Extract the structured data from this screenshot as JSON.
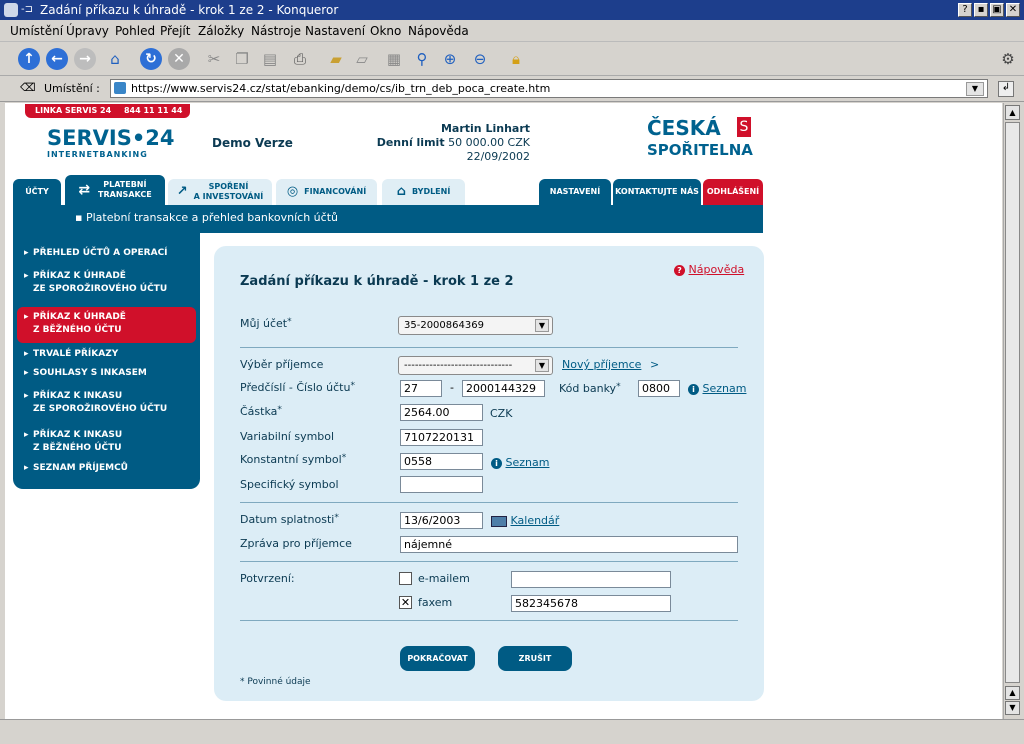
{
  "window": {
    "title": "Zadání příkazu k úhradě - krok 1 ze 2 - Konqueror",
    "btns": [
      "?",
      "▪",
      "▣",
      "✕"
    ]
  },
  "menu": [
    "Umístění",
    "Úpravy",
    "Pohled",
    "Přejít",
    "Záložky",
    "Nástroje",
    "Nastavení",
    "Okno",
    "Nápověda"
  ],
  "location": {
    "label": "Umístění :",
    "url": "https://www.servis24.cz/stat/ebanking/demo/cs/ib_trn_deb_poca_create.htm"
  },
  "header": {
    "hotline": "LINKA SERVIS 24",
    "phone": "844 11 11 44",
    "logo_main": "SERVIS•24",
    "logo_sub": "INTERNETBANKING",
    "demo": "Demo Verze",
    "user": "Martin Linhart",
    "limit_label": "Denní limit",
    "limit_value": "50 000.00 CZK",
    "date": "22/09/2002",
    "bank1": "ČESKÁ",
    "bank2": "SPOŘITELNA"
  },
  "tabs": {
    "ucty": "ÚČTY",
    "platebni1": "PLATEBNÍ",
    "platebni2": "TRANSAKCE",
    "sporeni1": "SPOŘENÍ",
    "sporeni2": "A INVESTOVÁNÍ",
    "financovani": "FINANCOVÁNÍ",
    "bydleni": "BYDLENÍ",
    "nastaveni": "NASTAVENÍ",
    "kontakt": "KONTAKTUJTE NÁS",
    "odhlaseni": "ODHLÁŠENÍ"
  },
  "subbar": "▪ Platební transakce a přehled bankovních účtů",
  "sidebar": [
    {
      "l1": "PŘEHLED ÚČTŮ A OPERACÍ",
      "l2": ""
    },
    {
      "l1": "PŘÍKAZ K ÚHRADĚ",
      "l2": "ZE SPOROŽIROVÉHO ÚČTU"
    },
    {
      "l1": "PŘÍKAZ K ÚHRADĚ",
      "l2": "Z BĚŽNÉHO ÚČTU"
    },
    {
      "l1": "TRVALÉ PŘÍKAZY",
      "l2": ""
    },
    {
      "l1": "SOUHLASY S INKASEM",
      "l2": ""
    },
    {
      "l1": "PŘÍKAZ K INKASU",
      "l2": "ZE SPOROŽIROVÉHO ÚČTU"
    },
    {
      "l1": "PŘÍKAZ K INKASU",
      "l2": "Z BĚŽNÉHO ÚČTU"
    },
    {
      "l1": "SEZNAM PŘÍJEMCŮ",
      "l2": ""
    }
  ],
  "form": {
    "title": "Zadání příkazu k úhradě - krok 1 ze 2",
    "help": "Nápověda",
    "muj_ucet_label": "Můj účet",
    "muj_ucet": "35-2000864369",
    "vyber_label": "Výběr příjemce",
    "vyber": "------------------------------",
    "novy": "Nový příjemce",
    "novy_arrow": ">",
    "predcisli_label": "Předčíslí - Číslo účtu",
    "predcisli": "27",
    "dash": "-",
    "cislo": "2000144329",
    "kod_label": "Kód banky",
    "kod": "0800",
    "seznam": "Seznam",
    "castka_label": "Částka",
    "castka": "2564.00",
    "mena": "CZK",
    "vs_label": "Variabilní symbol",
    "vs": "7107220131",
    "ks_label": "Konstantní symbol",
    "ks": "0558",
    "ss_label": "Specifický symbol",
    "ss": "",
    "datum_label": "Datum splatnosti",
    "datum": "13/6/2003",
    "kalendar": "Kalendář",
    "zprava_label": "Zpráva pro příjemce",
    "zprava": "nájemné",
    "potvrzeni_label": "Potvrzení:",
    "email_label": "e-mailem",
    "email": "",
    "fax_label": "faxem",
    "fax": "582345678",
    "pokracovat": "POKRAČOVAT",
    "zrusit": "ZRUŠIT",
    "povinne": "* Povinné údaje"
  }
}
